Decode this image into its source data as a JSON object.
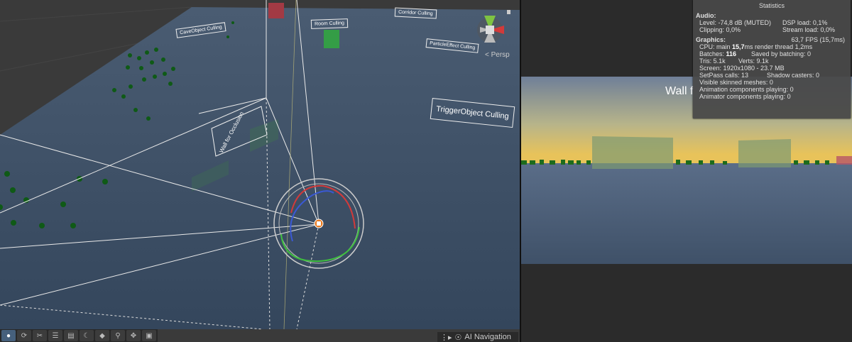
{
  "scene": {
    "labels": {
      "l1": "CaveObject Culling",
      "l2": "Room Culling",
      "l3": "Corridor Culling",
      "l4": "ParticleEffect Culling",
      "l5": "TriggerObject Culling",
      "l6": "Wall for Occlusion"
    },
    "persp_label": "< Persp",
    "ai_navigation_label": "AI Navigation",
    "toolbar": [
      "view-tool",
      "refresh",
      "scissors",
      "layers",
      "toggle",
      "moon",
      "layers-2",
      "search",
      "move",
      "camera"
    ]
  },
  "game": {
    "wall_label": "Wall f"
  },
  "stats": {
    "title": "Statistics",
    "audio_header": "Audio:",
    "level": "Level: -74,8 dB (MUTED)",
    "dsp_load": "DSP load: 0,1%",
    "clipping": "Clipping: 0,0%",
    "stream_load": "Stream load: 0,0%",
    "graphics_header": "Graphics:",
    "fps": "63,7 FPS (15,7ms)",
    "cpu_main_prefix": "CPU: main ",
    "cpu_main_value": "15,7",
    "cpu_main_suffix": "ms  render thread 1,2ms",
    "batches_prefix": "Batches: ",
    "batches_value": "116",
    "saved_by_batching": "Saved by batching: 0",
    "tris": "Tris: 5.1k",
    "verts": "Verts: 9.1k",
    "screen": "Screen: 1920x1080 - 23.7 MB",
    "setpass": "SetPass calls: 13",
    "shadow_casters": "Shadow casters: 0",
    "skinned": "Visible skinned meshes: 0",
    "animation": "Animation components playing: 0",
    "animator": "Animator components playing: 0"
  },
  "colors": {
    "ground": "#3f5168",
    "ground_dark": "#32435a",
    "tree": "#0f5a16",
    "sky_top": "#6f7f98",
    "sky_horizon": "#e8c35a"
  }
}
